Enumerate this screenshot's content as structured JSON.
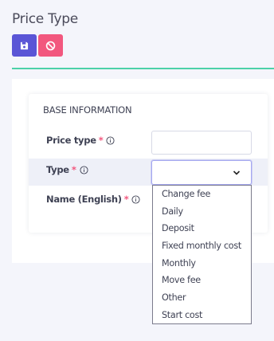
{
  "page": {
    "title": "Price Type"
  },
  "toolbar": {
    "save_icon": "floppy-disk-icon",
    "cancel_icon": "ban-icon"
  },
  "form": {
    "section_title": "BASE INFORMATION",
    "fields": {
      "price_type": {
        "label": "Price type",
        "required_mark": "*",
        "value": ""
      },
      "type": {
        "label": "Type",
        "required_mark": "*",
        "value": ""
      },
      "name_english": {
        "label": "Name (English)",
        "required_mark": "*"
      }
    },
    "type_options": [
      "Change fee",
      "Daily",
      "Deposit",
      "Fixed monthly cost",
      "Monthly",
      "Move fee",
      "Other",
      "Start cost"
    ]
  },
  "colors": {
    "accent": "#5a55d6",
    "danger": "#f2577e",
    "divider": "#4cd1a8"
  }
}
